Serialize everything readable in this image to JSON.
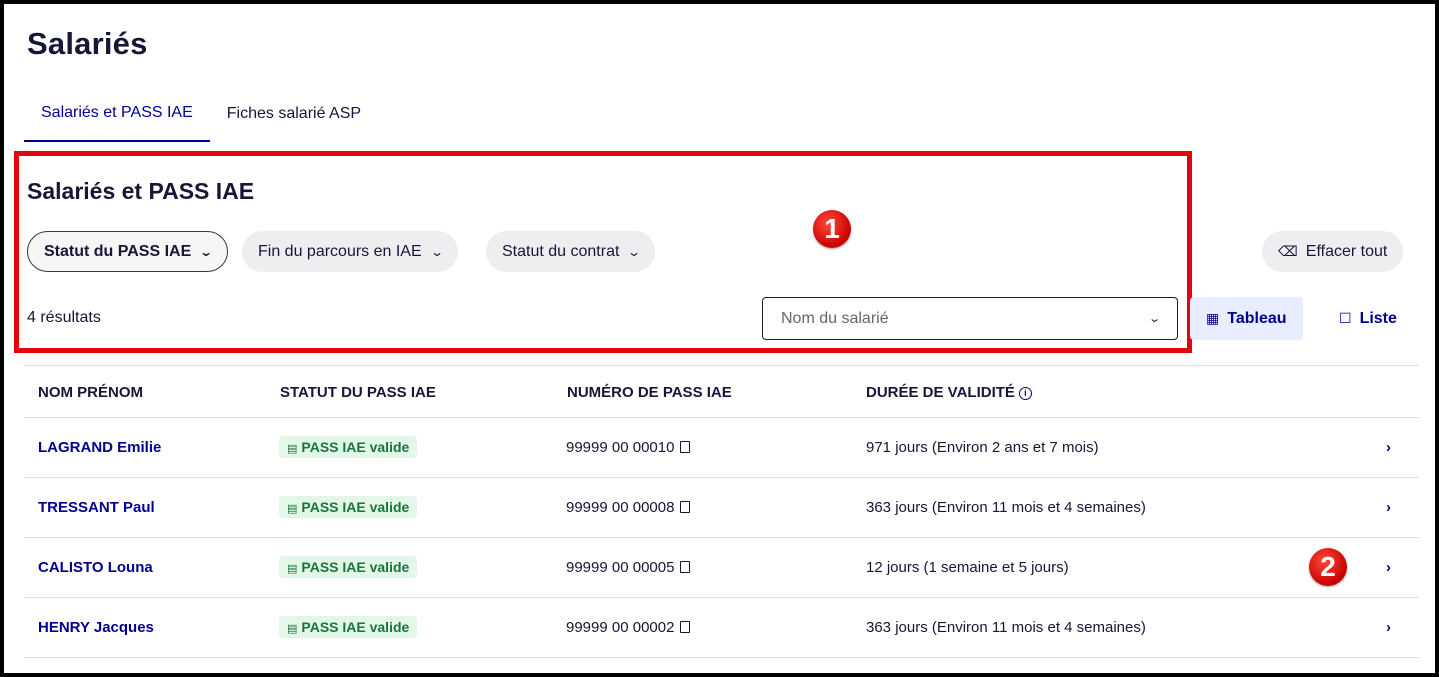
{
  "page": {
    "title": "Salariés"
  },
  "tabs": [
    {
      "label": "Salariés et PASS IAE",
      "active": true
    },
    {
      "label": "Fiches salarié ASP",
      "active": false
    }
  ],
  "section": {
    "title": "Salariés et PASS IAE"
  },
  "filters": [
    {
      "label": "Statut du PASS IAE",
      "active": true
    },
    {
      "label": "Fin du parcours en IAE",
      "active": false
    },
    {
      "label": "Statut du contrat",
      "active": false
    }
  ],
  "clear_all": {
    "label": "Effacer tout",
    "icon": "eraser-icon"
  },
  "results": {
    "count_text": "4 résultats"
  },
  "search": {
    "placeholder": "Nom du salarié"
  },
  "views": [
    {
      "label": "Tableau",
      "icon": "table-icon",
      "selected": true
    },
    {
      "label": "Liste",
      "icon": "list-icon",
      "selected": false
    }
  ],
  "annotations": [
    "1",
    "2"
  ],
  "table": {
    "headers": [
      "NOM PRÉNOM",
      "STATUT DU PASS IAE",
      "NUMÉRO DE PASS IAE",
      "DURÉE DE VALIDITÉ"
    ],
    "rows": [
      {
        "name": "LAGRAND Emilie",
        "status": "PASS IAE valide",
        "number": "99999 00 00010",
        "duration": "971 jours (Environ 2 ans et 7 mois)"
      },
      {
        "name": "TRESSANT Paul",
        "status": "PASS IAE valide",
        "number": "99999 00 00008",
        "duration": "363 jours (Environ 11 mois et 4 semaines)"
      },
      {
        "name": "CALISTO Louna",
        "status": "PASS IAE valide",
        "number": "99999 00 00005",
        "duration": "12 jours (1 semaine et 5 jours)"
      },
      {
        "name": "HENRY Jacques",
        "status": "PASS IAE valide",
        "number": "99999 00 00002",
        "duration": "363 jours (Environ 11 mois et 4 semaines)"
      }
    ]
  },
  "colors": {
    "primary": "#000091",
    "highlight": "#e2070c",
    "success": "#18753c"
  }
}
